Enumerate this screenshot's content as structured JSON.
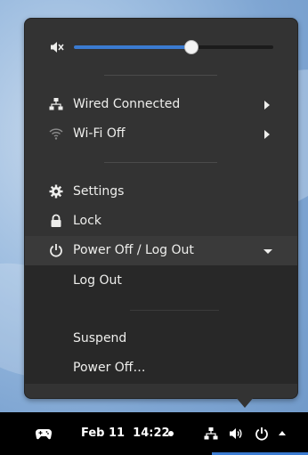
{
  "volume": {
    "level_percent": 59,
    "muted": true,
    "icon": "speaker-muted-icon"
  },
  "network": {
    "wired": {
      "label": "Wired Connected",
      "icon": "wired-network-icon"
    },
    "wifi": {
      "label": "Wi-Fi Off",
      "icon": "wifi-off-icon"
    }
  },
  "actions": {
    "settings": {
      "label": "Settings",
      "icon": "gear-icon"
    },
    "lock": {
      "label": "Lock",
      "icon": "lock-icon"
    }
  },
  "power": {
    "header_label": "Power Off / Log Out",
    "icon": "power-icon",
    "expanded": true,
    "items": [
      {
        "label": "Log Out"
      },
      {
        "label": "Suspend"
      },
      {
        "label": "Power Off…"
      }
    ]
  },
  "panel": {
    "date": "Feb 11",
    "time": "14:22",
    "accent_color": "#3b7bd1",
    "icons": [
      "gamepad-icon",
      "wired-network-icon",
      "volume-icon",
      "power-icon",
      "chevron-up-icon"
    ]
  },
  "colors": {
    "menu_bg": "#333333",
    "accent": "#3b7bd1"
  }
}
